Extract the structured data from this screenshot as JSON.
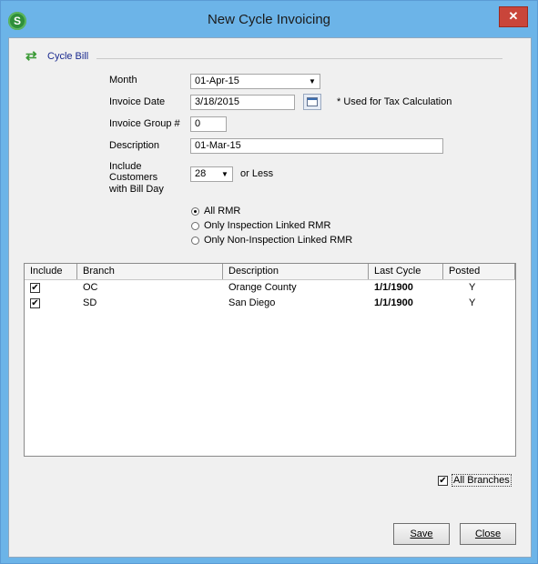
{
  "window": {
    "title": "New Cycle Invoicing",
    "app_icon_letter": "S",
    "close_glyph": "✕"
  },
  "section": {
    "title": "Cycle Bill",
    "icon": "refresh-cycle-icon"
  },
  "form": {
    "month_label": "Month",
    "month_value": "01-Apr-15",
    "invoice_date_label": "Invoice Date",
    "invoice_date_value": "3/18/2015",
    "tax_note": "* Used for Tax Calculation",
    "invoice_group_label": "Invoice Group #",
    "invoice_group_value": "0",
    "description_label": "Description",
    "description_value": "01-Mar-15",
    "include_label_1": "Include",
    "include_label_2": "Customers",
    "include_label_3": "with Bill Day",
    "bill_day_value": "28",
    "or_less": "or Less"
  },
  "radios": [
    {
      "label": "All RMR",
      "selected": true
    },
    {
      "label": "Only Inspection Linked RMR",
      "selected": false
    },
    {
      "label": "Only Non-Inspection Linked RMR",
      "selected": false
    }
  ],
  "grid": {
    "columns": [
      "Include",
      "Branch",
      "Description",
      "Last Cycle",
      "Posted"
    ],
    "rows": [
      {
        "include": true,
        "branch": "OC",
        "description": "Orange County",
        "last_cycle": "1/1/1900",
        "posted": "Y"
      },
      {
        "include": true,
        "branch": "SD",
        "description": "San Diego",
        "last_cycle": "1/1/1900",
        "posted": "Y"
      }
    ]
  },
  "all_branches": {
    "label": "All Branches",
    "checked": true
  },
  "buttons": {
    "save": "Save",
    "close": "Close"
  },
  "colors": {
    "titlebar": "#6cb4e8",
    "close": "#c9453a",
    "section_title": "#1a2a8f"
  }
}
